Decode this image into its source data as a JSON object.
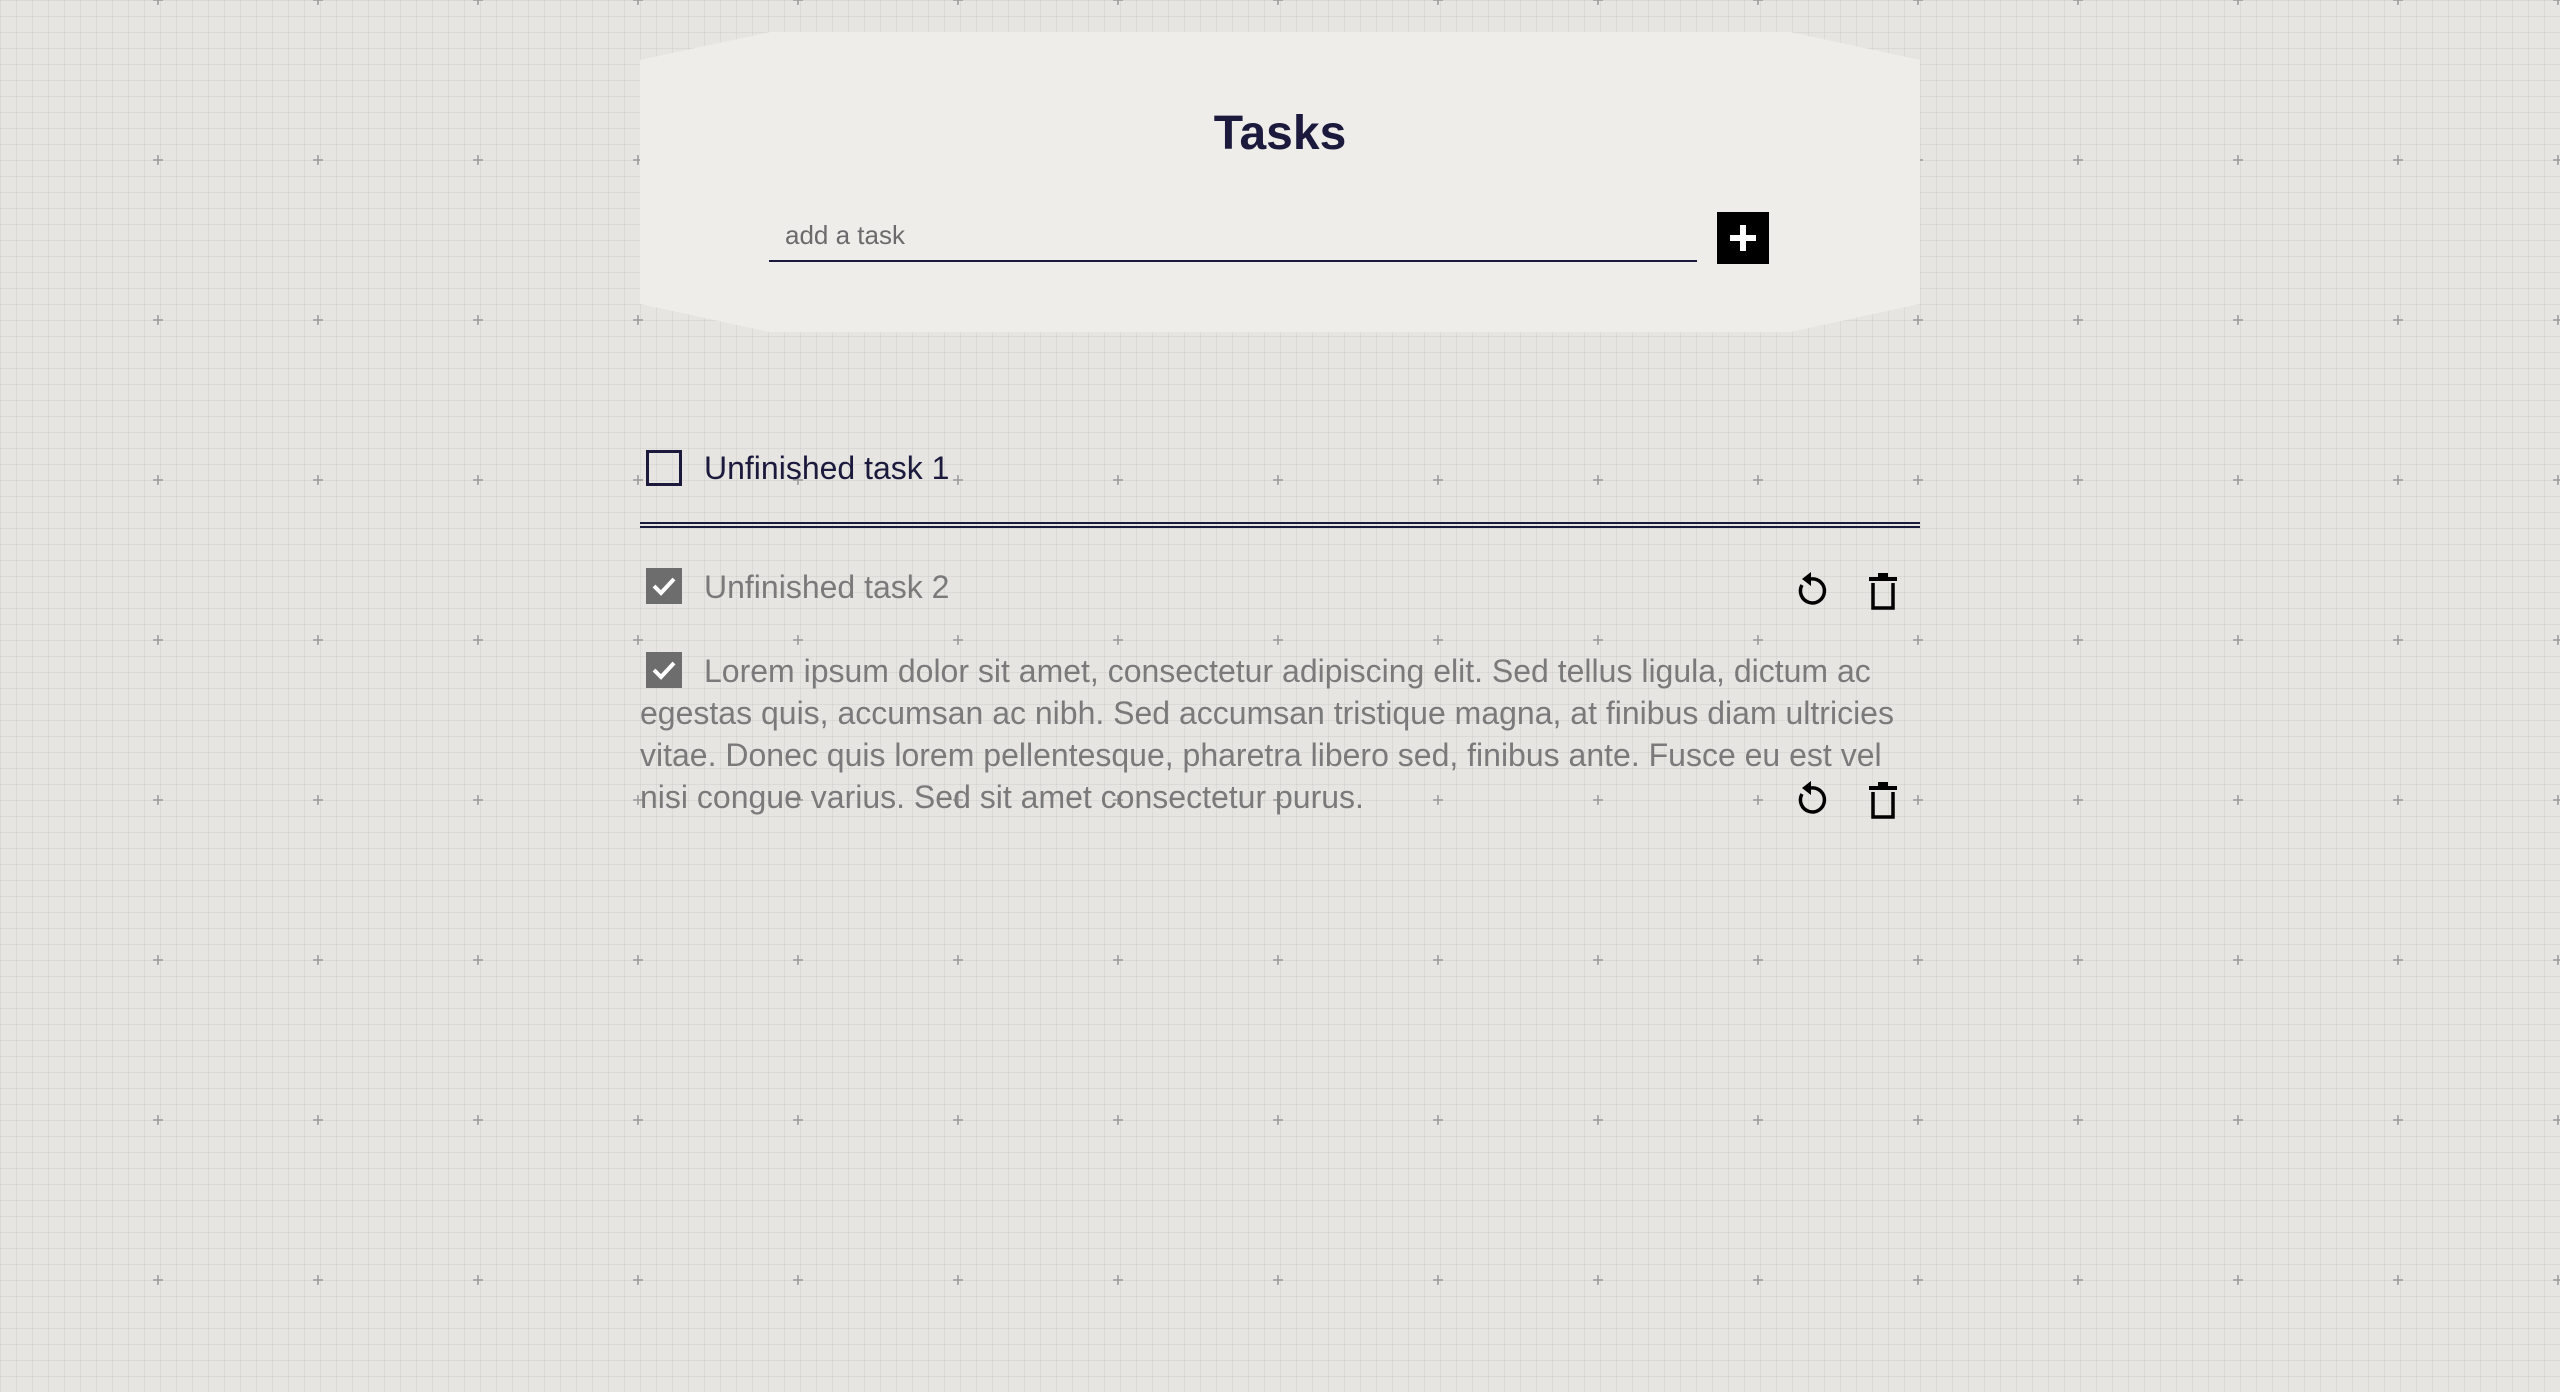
{
  "header": {
    "title": "Tasks"
  },
  "add_task": {
    "placeholder": "add a task",
    "value": "",
    "button_icon": "plus-icon"
  },
  "tasks": [
    {
      "text": "Unfinished task 1",
      "completed": false
    },
    {
      "text": "Unfinished task 2",
      "completed": true,
      "actions": [
        "undo-icon",
        "trash-icon"
      ]
    },
    {
      "text": "Lorem ipsum dolor sit amet, consectetur adipiscing elit. Sed tellus ligula, dictum ac egestas quis, accumsan ac nibh. Sed accumsan tristique magna, at finibus diam ultricies vitae. Donec quis lorem pellentesque, pharetra libero sed, finibus ante. Fusce eu est vel nisi congue varius. Sed sit amet consectetur purus.",
      "completed": true,
      "actions": [
        "undo-icon",
        "trash-icon"
      ]
    }
  ],
  "colors": {
    "background": "#e6e5e1",
    "card": "#efedea",
    "text_primary": "#1b1a3d",
    "text_done": "#7a7a7a",
    "checkbox_checked": "#6d6d6d"
  }
}
